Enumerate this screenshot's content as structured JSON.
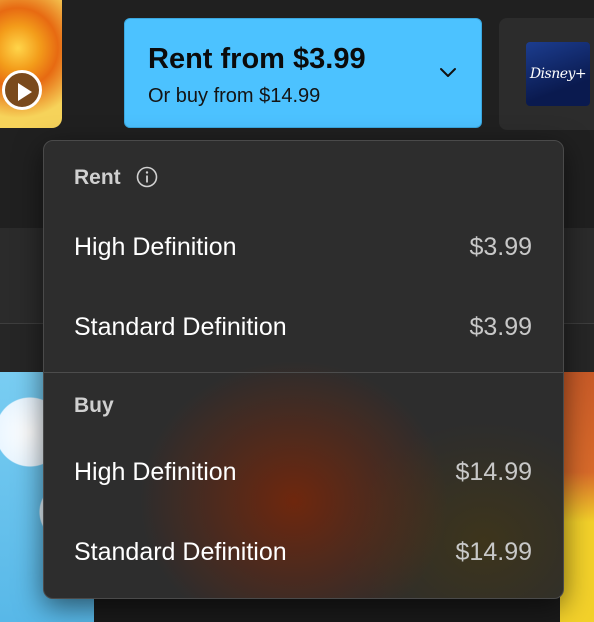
{
  "rent_button": {
    "title": "Rent from $3.99",
    "subtitle": "Or buy from $14.99"
  },
  "partner": {
    "logo_text": "Disney+"
  },
  "menu": {
    "rent_header": "Rent",
    "rent_items": [
      {
        "label": "High Definition",
        "price": "$3.99"
      },
      {
        "label": "Standard Definition",
        "price": "$3.99"
      }
    ],
    "buy_header": "Buy",
    "buy_items": [
      {
        "label": "High Definition",
        "price": "$14.99"
      },
      {
        "label": "Standard Definition",
        "price": "$14.99"
      }
    ]
  },
  "icons": {
    "play": "play-icon",
    "chevron": "chevron-down-icon",
    "info": "info-icon"
  },
  "colors": {
    "accent": "#4cc2ff",
    "menu_background": "#2d2d2d",
    "text_primary": "#ffffff",
    "text_secondary": "#c8c8c8"
  }
}
